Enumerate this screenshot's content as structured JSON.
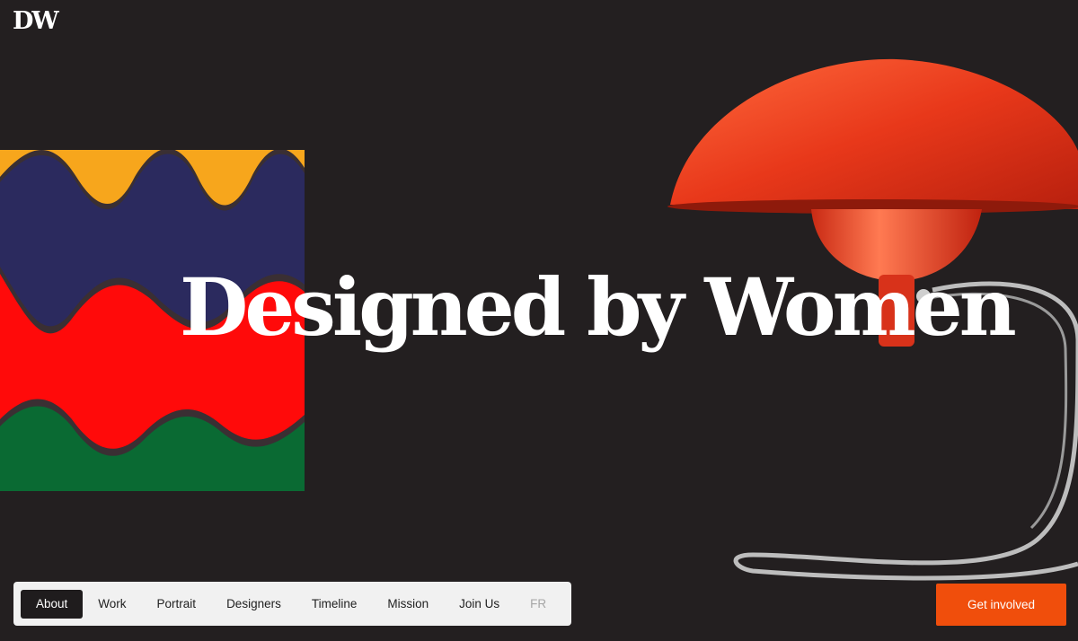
{
  "brand": {
    "logo_text": "DW"
  },
  "hero": {
    "title": "Designed by Women"
  },
  "nav": {
    "items": [
      {
        "label": "About",
        "active": true
      },
      {
        "label": "Work"
      },
      {
        "label": "Portrait"
      },
      {
        "label": "Designers"
      },
      {
        "label": "Timeline"
      },
      {
        "label": "Mission"
      },
      {
        "label": "Join Us"
      },
      {
        "label": "FR",
        "muted": true
      }
    ]
  },
  "cta": {
    "label": "Get involved"
  },
  "colors": {
    "background": "#231f20",
    "accent": "#f04e0c",
    "nav_background": "#f1f1f1",
    "nav_active": "#1f1c1d",
    "artwork_yellow": "#f7a61c",
    "artwork_navy": "#2b2a5e",
    "artwork_red": "#ff0a0a",
    "artwork_green": "#0a6a33",
    "lamp_red": "#e8381a"
  },
  "images": {
    "artwork": "colorful-wave-pattern-artwork",
    "lamp": "red-desk-lamp-photo"
  }
}
